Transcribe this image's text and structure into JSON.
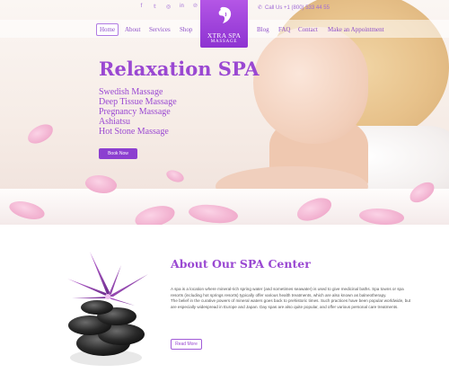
{
  "brand": {
    "name": "XTRA SPA",
    "tagline": "MASSAGE",
    "accent": "#9a48d2",
    "logo_bg": "#a045dc"
  },
  "topbar": {
    "social_icons": [
      {
        "name": "facebook-icon",
        "glyph": "f"
      },
      {
        "name": "twitter-icon",
        "glyph": "𝕥"
      },
      {
        "name": "instagram-icon",
        "glyph": "◎"
      },
      {
        "name": "linkedin-icon",
        "glyph": "in"
      },
      {
        "name": "pinterest-icon",
        "glyph": "℗"
      }
    ],
    "phone_icon": "phone-icon",
    "phone": "Call Us +1 (800) 533 44 55"
  },
  "nav": {
    "left": [
      "Home",
      "About",
      "Services",
      "Shop"
    ],
    "right": [
      "Blog",
      "FAQ",
      "Contact",
      "Make an Appointment"
    ]
  },
  "hero": {
    "title": "Relaxation SPA",
    "services": [
      "Swedish Massage",
      "Deep Tissue Massage",
      "Pregnancy Massage",
      "Ashiatsu",
      "Hot Stone Massage"
    ],
    "button": "Book Now"
  },
  "about": {
    "title": "About Our SPA Center",
    "paragraph1": "A spa is a location where mineral-rich spring water (and sometimes seawater) is used to give medicinal baths. Spa towns or spa resorts (including hot springs resorts) typically offer various health treatments, which are also known as balneotherapy.",
    "paragraph2": "The belief in the curative powers of mineral waters goes back to prehistoric times. Such practices have been popular worldwide, but are especially widespread in Europe and Japan. Day spas are also quite popular, and offer various personal care treatments.",
    "button": "Read More"
  }
}
